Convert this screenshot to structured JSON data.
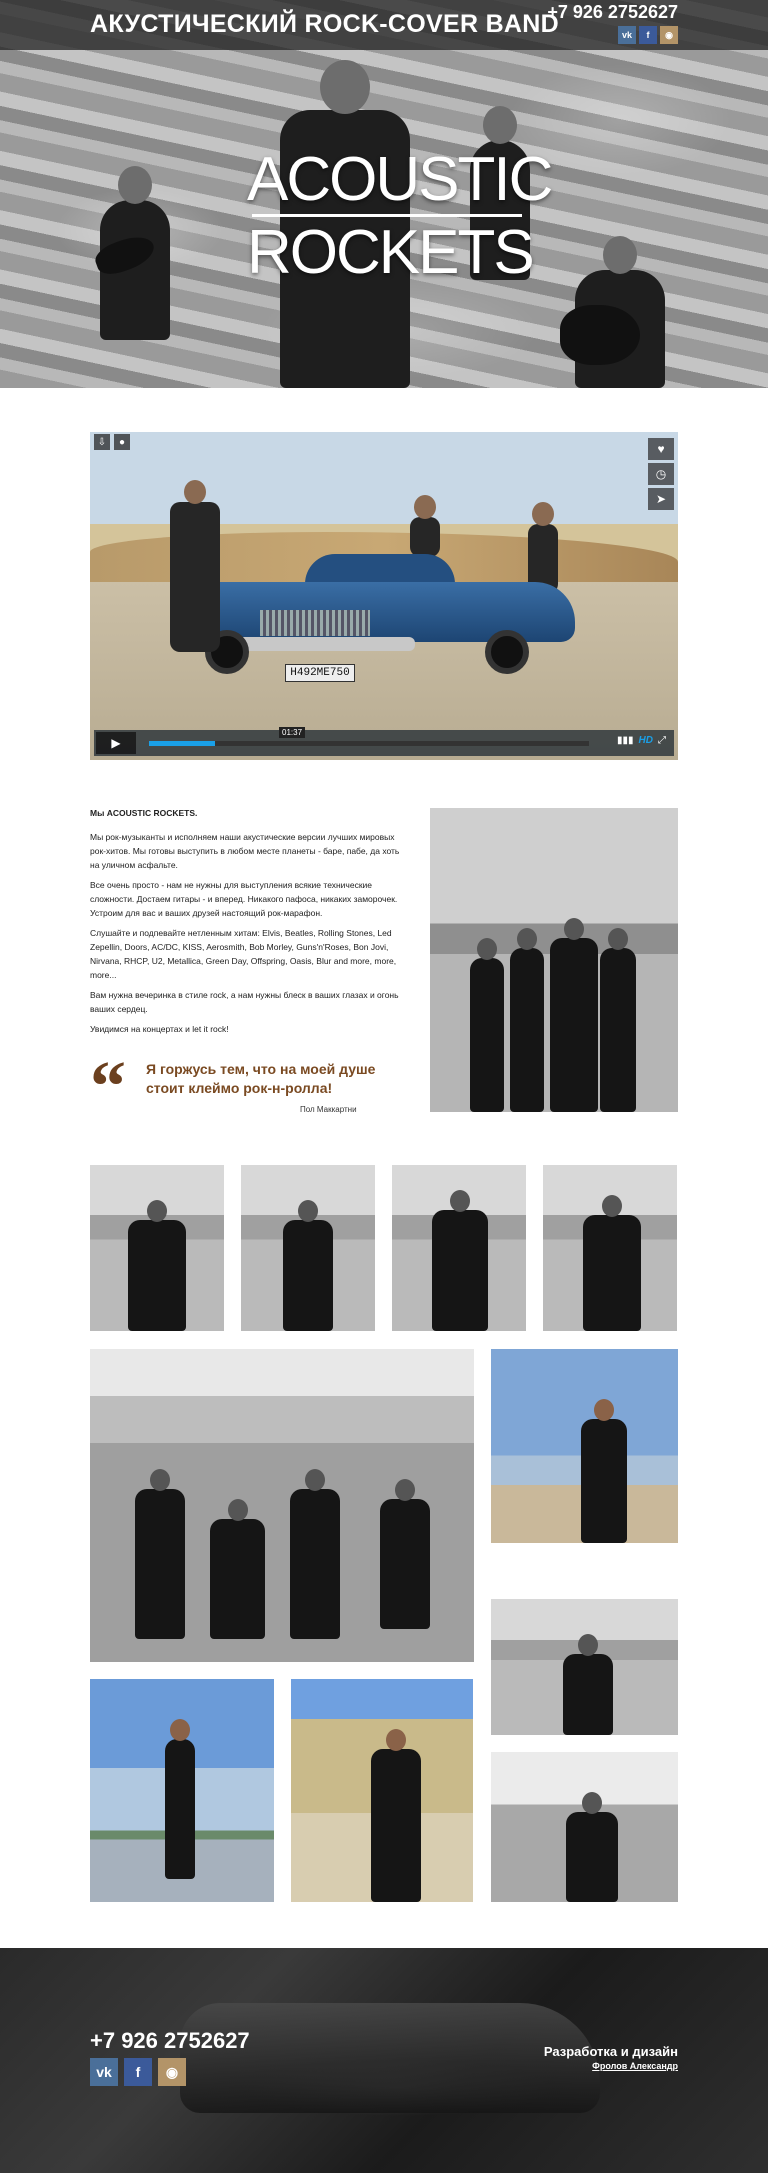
{
  "header": {
    "title": "АКУСТИЧЕСКИЙ ROCK-COVER BAND",
    "phone": "+7 926 2752627",
    "socials": [
      "vk-icon",
      "facebook-icon",
      "instagram-icon"
    ]
  },
  "logo": {
    "line1": "ACOUSTIC",
    "line2": "ROCKETS"
  },
  "video": {
    "plate": "Н492МЕ750",
    "time_tip": "01:37",
    "hd_label": "HD",
    "progress": 0.15
  },
  "about": {
    "intro": "Мы ACOUSTIC ROCKETS.",
    "p1": "Мы рок-музыканты и исполняем наши акустические версии лучших мировых рок-хитов. Мы готовы выступить в любом месте планеты - баре, пабе, да хоть на уличном асфальте.",
    "p2": "Все очень просто - нам не нужны для выступления всякие технические сложности. Достаем гитары - и вперед. Никакого пафоса, никаких заморочек. Устроим для вас и ваших друзей настоящий рок-марафон.",
    "p3": "Слушайте и подпевайте нетленным хитам: Elvis, Beatles, Rolling Stones, Led Zepellin, Doors, AC/DC, KISS, Aerosmith, Bob Morley, Guns'n'Roses, Bon Jovi, Nirvana, RHCP, U2, Metallica, Green Day, Offspring, Oasis, Blur and more, more, more...",
    "p4": "Вам нужна вечеринка в стиле rock, а нам нужны блеск в ваших глазах и огонь ваших сердец.",
    "p5": "Увидимся на концертах и let it rock!"
  },
  "quote": {
    "text": "Я горжусь тем, что на моей душе стоит клеймо рок-н-ролла!",
    "author": "Пол Маккартни"
  },
  "footer": {
    "phone": "+7 926 2752627",
    "dev_title": "Разработка и дизайн",
    "dev_name": "Фролов Александр"
  }
}
